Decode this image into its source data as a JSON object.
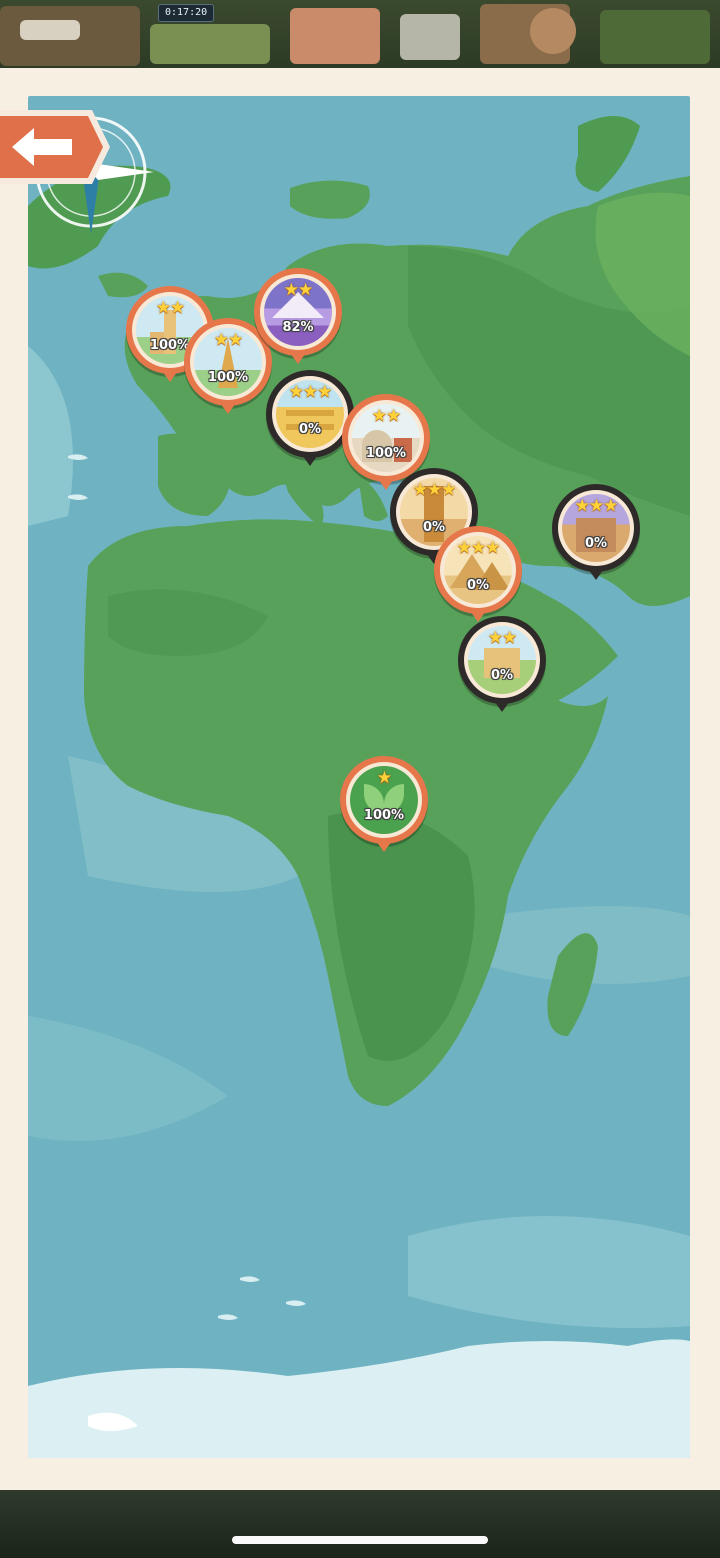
{
  "status": {
    "timer": "0:17:20"
  },
  "map": {
    "pins": [
      {
        "id": "london",
        "stars": "★★",
        "percent": "100%",
        "theme": "light",
        "art": "clock-tower"
      },
      {
        "id": "paris",
        "stars": "★★",
        "percent": "100%",
        "theme": "light",
        "art": "eiffel-tower"
      },
      {
        "id": "alps",
        "stars": "★★",
        "percent": "82%",
        "theme": "light",
        "art": "mountain-lavender"
      },
      {
        "id": "rome",
        "stars": "★★★",
        "percent": "0%",
        "theme": "dark",
        "art": "colosseum"
      },
      {
        "id": "athens",
        "stars": "★★",
        "percent": "100%",
        "theme": "light",
        "art": "temple"
      },
      {
        "id": "babylon",
        "stars": "★★★",
        "percent": "0%",
        "theme": "dark",
        "art": "ziggurat-tower"
      },
      {
        "id": "asia",
        "stars": "★★★",
        "percent": "0%",
        "theme": "dark",
        "art": "palace"
      },
      {
        "id": "giza",
        "stars": "★★★",
        "percent": "0%",
        "theme": "dark",
        "art": "pyramids"
      },
      {
        "id": "desert",
        "stars": "★★",
        "percent": "0%",
        "theme": "dark",
        "art": "mud-house"
      },
      {
        "id": "jungle",
        "stars": "★",
        "percent": "100%",
        "theme": "light",
        "art": "leaf"
      }
    ]
  },
  "icons": {
    "back": "back-arrow-icon",
    "compass": "compass-rose-icon"
  },
  "colors": {
    "ocean": "#6fb3c2",
    "land": "#58a15a",
    "land_dark": "#3f8a46",
    "pin_orange": "#e6774a",
    "pin_dark": "#2e2a29",
    "star": "#ffd23a",
    "frame": "#f6efe2"
  }
}
